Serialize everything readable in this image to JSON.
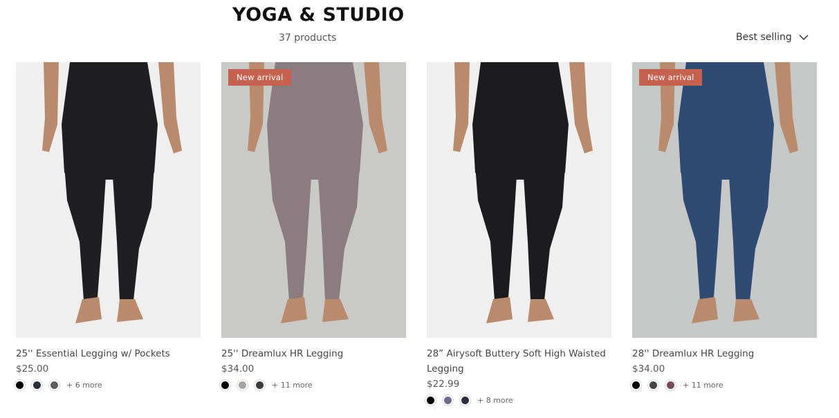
{
  "collection": {
    "title": "YOGA & STUDIO",
    "count": "37 products"
  },
  "sort": {
    "label": "Best selling",
    "icon": "chevron-down-icon"
  },
  "products": [
    {
      "title": "25'' Essential Legging w/ Pockets",
      "price": "$25.00",
      "badge": "",
      "image_bg": "#efefef",
      "legging_color": "#1f1f22",
      "swatches": [
        "#000000",
        "#2a2d3a",
        "#5a5c60"
      ],
      "more": "+ 6 more"
    },
    {
      "title": "25'' Dreamlux HR Legging",
      "price": "$34.00",
      "badge": "New arrival",
      "image_bg": "#c9c9c7",
      "legging_color": "#8a7c80",
      "swatches": [
        "#000000",
        "#a8a2a0",
        "#3d3d40"
      ],
      "more": "+ 11 more"
    },
    {
      "title": "28” Airysoft Buttery Soft High Waisted Legging",
      "price": "$22.99",
      "badge": "",
      "image_bg": "#efefef",
      "legging_color": "#1c1c1e",
      "swatches": [
        "#000000",
        "#6b6b8d",
        "#2c2e3f"
      ],
      "more": "+ 8 more"
    },
    {
      "title": "28'' Dreamlux HR Legging",
      "price": "$34.00",
      "badge": "New arrival",
      "image_bg": "#c6c8c8",
      "legging_color": "#2f4b73",
      "swatches": [
        "#000000",
        "#444648",
        "#7a4a55"
      ],
      "more": "+ 11 more"
    }
  ]
}
